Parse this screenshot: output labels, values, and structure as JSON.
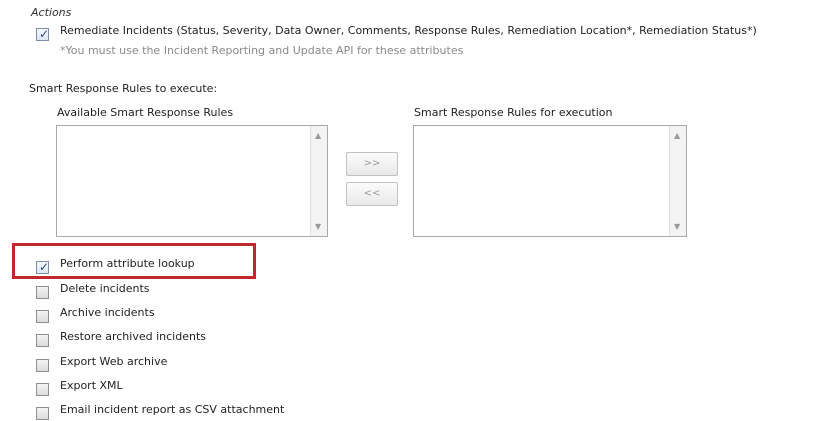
{
  "actions": {
    "title": "Actions",
    "remediate_label": "Remediate Incidents (Status, Severity, Data Owner, Comments, Response Rules, Remediation Location*, Remediation Status*)",
    "remediate_note": "*You must use the Incident Reporting and Update API for these attributes"
  },
  "smart_response": {
    "heading": "Smart Response Rules to execute:",
    "available_label": "Available Smart Response Rules",
    "execution_label": "Smart Response Rules for execution",
    "add_button": ">>",
    "remove_button": "<<"
  },
  "options": [
    {
      "label": "Perform attribute lookup",
      "checked": true
    },
    {
      "label": "Delete incidents",
      "checked": false
    },
    {
      "label": "Archive incidents",
      "checked": false
    },
    {
      "label": "Restore archived incidents",
      "checked": false
    },
    {
      "label": "Export Web archive",
      "checked": false
    },
    {
      "label": "Export XML",
      "checked": false
    },
    {
      "label": "Email incident report as CSV attachment",
      "checked": false
    }
  ],
  "colors": {
    "highlight": "#c1272d"
  }
}
